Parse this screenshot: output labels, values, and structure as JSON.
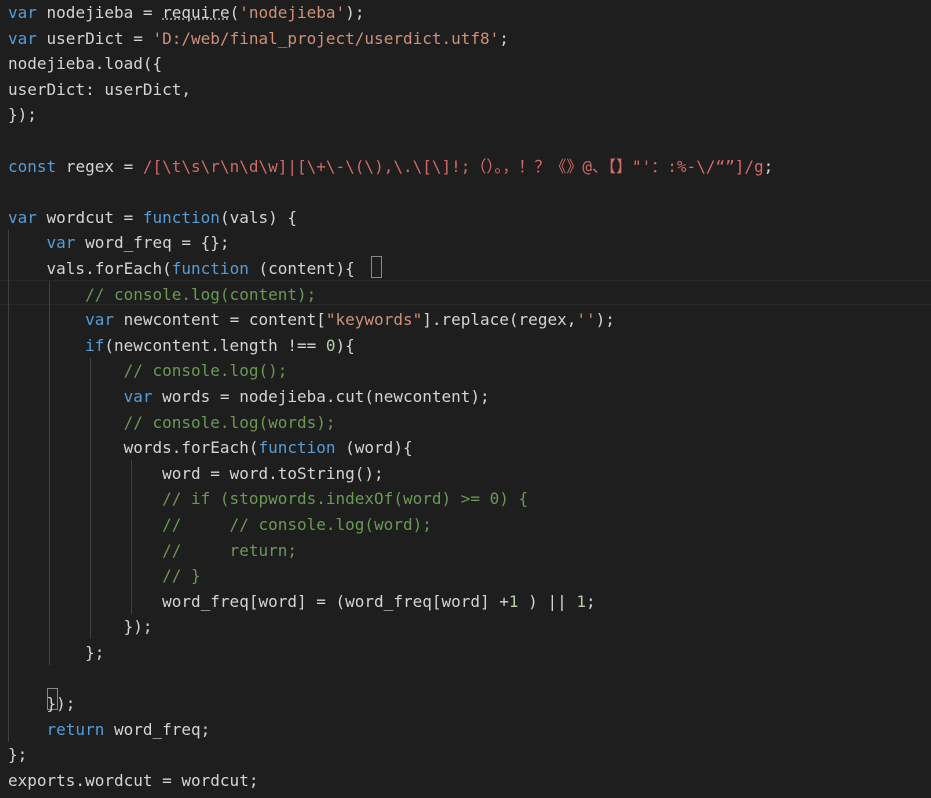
{
  "editor": {
    "theme_colors": {
      "background": "#1e1e1e",
      "keyword": "#569cd6",
      "string": "#ce9178",
      "regex": "#d16969",
      "comment": "#6a9955",
      "number": "#b5cea8",
      "text": "#d4d4d4"
    },
    "lines": [
      [
        {
          "t": "var",
          "c": "kw"
        },
        {
          "t": " nodejieba = ",
          "c": "tx"
        },
        {
          "t": "require",
          "c": "tx",
          "u": true
        },
        {
          "t": "(",
          "c": "tx"
        },
        {
          "t": "'nodejieba'",
          "c": "str"
        },
        {
          "t": ");",
          "c": "tx"
        }
      ],
      [
        {
          "t": "var",
          "c": "kw"
        },
        {
          "t": " userDict = ",
          "c": "tx"
        },
        {
          "t": "'D:/web/final_project/userdict.utf8'",
          "c": "str"
        },
        {
          "t": ";",
          "c": "tx"
        }
      ],
      [
        {
          "t": "nodejieba.load({",
          "c": "tx"
        }
      ],
      [
        {
          "t": "userDict: userDict,",
          "c": "tx"
        }
      ],
      [
        {
          "t": "});",
          "c": "tx"
        }
      ],
      [],
      [
        {
          "t": "const",
          "c": "kw"
        },
        {
          "t": " regex = ",
          "c": "tx"
        },
        {
          "t": "/[\\t\\s\\r\\n\\d\\w]|[\\+\\-\\(\\),\\.\\[\\]!;（）。，！？《》@、【】\"'：:%-\\/“”]/g",
          "c": "re"
        },
        {
          "t": ";",
          "c": "tx"
        }
      ],
      [],
      [
        {
          "t": "var",
          "c": "kw"
        },
        {
          "t": " wordcut = ",
          "c": "tx"
        },
        {
          "t": "function",
          "c": "kw"
        },
        {
          "t": "(vals) {",
          "c": "tx"
        }
      ],
      [
        {
          "t": "    ",
          "c": "tx"
        },
        {
          "t": "var",
          "c": "kw"
        },
        {
          "t": " word_freq = {};",
          "c": "tx"
        }
      ],
      [
        {
          "t": "    vals.forEach(",
          "c": "tx"
        },
        {
          "t": "function",
          "c": "kw"
        },
        {
          "t": " (content){",
          "c": "tx"
        }
      ],
      [
        {
          "t": "        ",
          "c": "tx"
        },
        {
          "t": "// console.log(content);",
          "c": "cm"
        }
      ],
      [
        {
          "t": "        ",
          "c": "tx"
        },
        {
          "t": "var",
          "c": "kw"
        },
        {
          "t": " newcontent = content[",
          "c": "tx"
        },
        {
          "t": "\"keywords\"",
          "c": "str"
        },
        {
          "t": "].replace(regex,",
          "c": "tx"
        },
        {
          "t": "''",
          "c": "str"
        },
        {
          "t": ");",
          "c": "tx"
        }
      ],
      [
        {
          "t": "        ",
          "c": "tx"
        },
        {
          "t": "if",
          "c": "kw"
        },
        {
          "t": "(newcontent.length !== ",
          "c": "tx"
        },
        {
          "t": "0",
          "c": "num"
        },
        {
          "t": "){",
          "c": "tx"
        }
      ],
      [
        {
          "t": "            ",
          "c": "tx"
        },
        {
          "t": "// console.log();",
          "c": "cm"
        }
      ],
      [
        {
          "t": "            ",
          "c": "tx"
        },
        {
          "t": "var",
          "c": "kw"
        },
        {
          "t": " words = nodejieba.cut(newcontent);",
          "c": "tx"
        }
      ],
      [
        {
          "t": "            ",
          "c": "tx"
        },
        {
          "t": "// console.log(words);",
          "c": "cm"
        }
      ],
      [
        {
          "t": "            words.forEach(",
          "c": "tx"
        },
        {
          "t": "function",
          "c": "kw"
        },
        {
          "t": " (word){",
          "c": "tx"
        }
      ],
      [
        {
          "t": "                word = word.toString();",
          "c": "tx"
        }
      ],
      [
        {
          "t": "                ",
          "c": "tx"
        },
        {
          "t": "// if (stopwords.indexOf(word) >= 0) {",
          "c": "cm"
        }
      ],
      [
        {
          "t": "                ",
          "c": "tx"
        },
        {
          "t": "//     // console.log(word);",
          "c": "cm"
        }
      ],
      [
        {
          "t": "                ",
          "c": "tx"
        },
        {
          "t": "//     return;",
          "c": "cm"
        }
      ],
      [
        {
          "t": "                ",
          "c": "tx"
        },
        {
          "t": "// }",
          "c": "cm"
        }
      ],
      [
        {
          "t": "                word_freq[word] = (word_freq[word] +",
          "c": "tx"
        },
        {
          "t": "1",
          "c": "num"
        },
        {
          "t": " ) || ",
          "c": "tx"
        },
        {
          "t": "1",
          "c": "num"
        },
        {
          "t": ";",
          "c": "tx"
        }
      ],
      [
        {
          "t": "            });",
          "c": "tx"
        }
      ],
      [
        {
          "t": "        };",
          "c": "tx"
        }
      ],
      [],
      [
        {
          "t": "    });",
          "c": "tx"
        }
      ],
      [
        {
          "t": "    ",
          "c": "tx"
        },
        {
          "t": "return",
          "c": "kw"
        },
        {
          "t": " word_freq;",
          "c": "tx"
        }
      ],
      [
        {
          "t": "};",
          "c": "tx"
        }
      ],
      [
        {
          "t": "exports.wordcut = wordcut;",
          "c": "tx"
        }
      ]
    ]
  }
}
